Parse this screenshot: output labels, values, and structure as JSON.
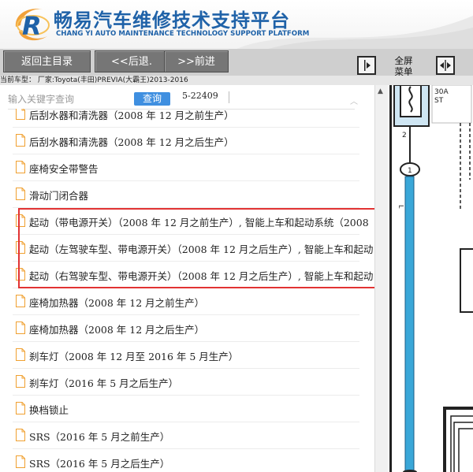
{
  "header": {
    "title": "畅易汽车维修技术支持平台",
    "subtitle": "CHANG YI AUTO MAINTENANCE TECHNOLOGY SUPPORT PLATFORM",
    "logo_letter": "R"
  },
  "toolbar": {
    "back_main_label": "返回主目录",
    "back_label": "<<后退.",
    "forward_label": ">>前进",
    "fullscreen_label_1": "全屏",
    "fullscreen_label_2": "菜单"
  },
  "vehicle": {
    "text": "当前车型： 厂家:Toyota(丰田)PREVIA(大霸王)2013-2016"
  },
  "search": {
    "placeholder": "输入关键字查询",
    "button_label": "查询",
    "code": "5-22409"
  },
  "list": {
    "items": [
      {
        "label": "后刮水器和清洗器（2008 年 12 月之前生产）"
      },
      {
        "label": "后刮水器和清洗器（2008 年 12 月之后生产）"
      },
      {
        "label": "座椅安全带警告"
      },
      {
        "label": "滑动门闭合器"
      },
      {
        "label": "起动（带电源开关）（2008 年 12 月之前生产）, 智能上车和起动系统（2008"
      },
      {
        "label": "起动（左驾驶车型、带电源开关）（2008 年 12 月之后生产）, 智能上车和起动"
      },
      {
        "label": "起动（右驾驶车型、带电源开关）（2008 年 12 月之后生产）, 智能上车和起动"
      },
      {
        "label": "座椅加热器（2008 年 12 月之前生产）"
      },
      {
        "label": "座椅加热器（2008 年 12 月之后生产）"
      },
      {
        "label": "刹车灯（2008 年 12 月至 2016 年 5 月生产）"
      },
      {
        "label": "刹车灯（2016 年 5 月之后生产）"
      },
      {
        "label": "换档锁止"
      },
      {
        "label": "SRS（2016 年 5 月之前生产）"
      },
      {
        "label": "SRS（2016 年 5 月之后生产）"
      }
    ]
  },
  "diagram": {
    "fuse_label_1": "30A",
    "fuse_label_2": "ST",
    "pin_number": "2",
    "connector_number": "1",
    "wire_color": "L"
  },
  "colors": {
    "brand_blue": "#1f62a8",
    "button_gray": "#767676",
    "search_blue": "#3f8fe0",
    "highlight_red": "#e23333",
    "wire_blue": "#3aa7d8"
  }
}
